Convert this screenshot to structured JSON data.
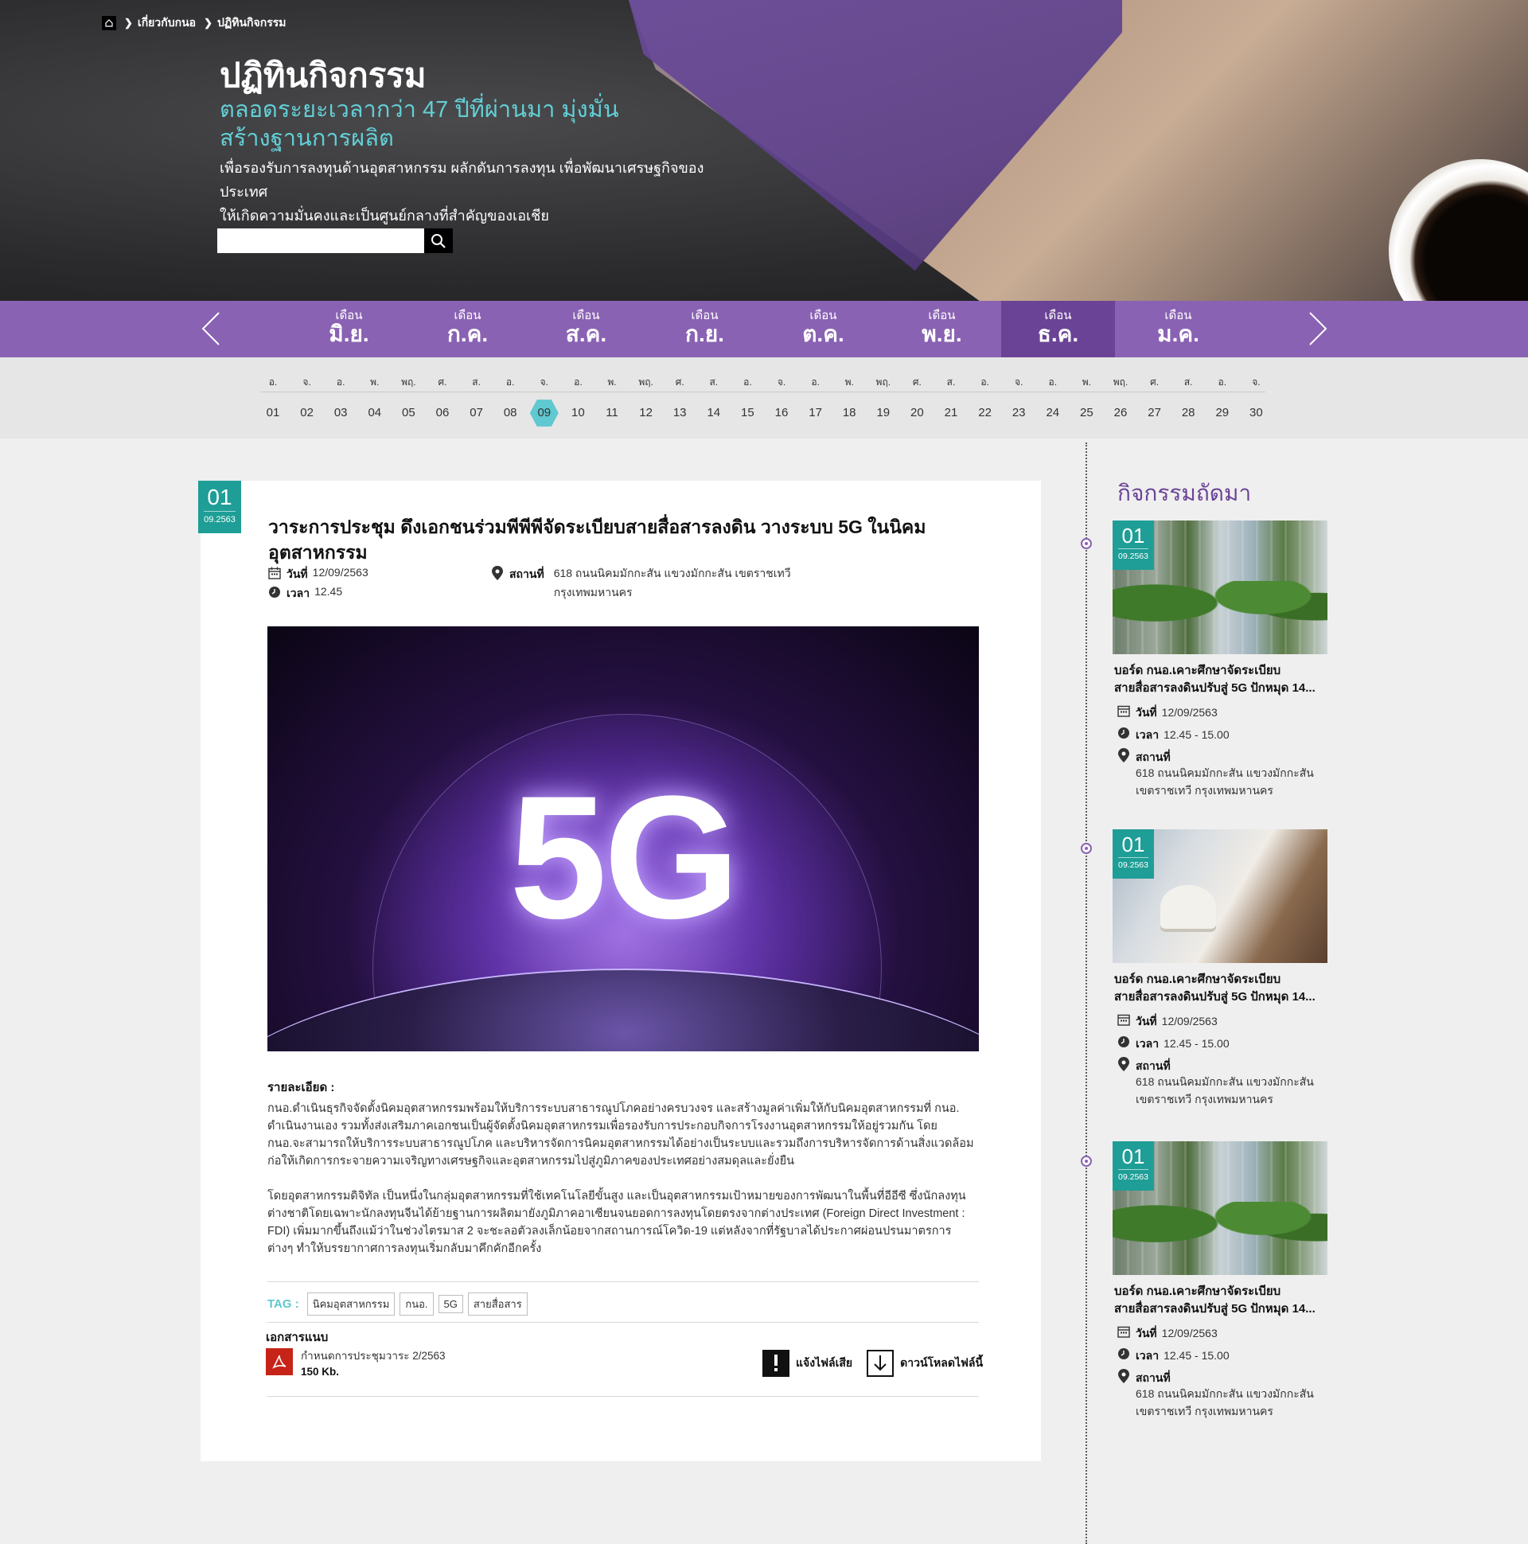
{
  "breadcrumb": {
    "items": [
      "เกี่ยวกับกนอ",
      "ปฏิทินกิจกรรม"
    ]
  },
  "hero": {
    "title": "ปฏิทินกิจกรรม",
    "subtitle": "ตลอดระยะเวลากว่า 47 ปีที่ผ่านมา มุ่งมั่นสร้างฐานการผลิต",
    "description_line1": "เพื่อรองรับการลงทุนด้านอุตสาหกรรม ผลักดันการลงทุน เพื่อพัฒนาเศรษฐกิจของประเทศ",
    "description_line2": "ให้เกิดความมั่นคงและเป็นศูนย์กลางที่สำคัญของเอเชีย",
    "search_placeholder": ""
  },
  "months": [
    {
      "small": "เดือน",
      "big": "มิ.ย.",
      "active": false
    },
    {
      "small": "เดือน",
      "big": "ก.ค.",
      "active": false
    },
    {
      "small": "เดือน",
      "big": "ส.ค.",
      "active": false
    },
    {
      "small": "เดือน",
      "big": "ก.ย.",
      "active": false
    },
    {
      "small": "เดือน",
      "big": "ต.ค.",
      "active": false
    },
    {
      "small": "เดือน",
      "big": "พ.ย.",
      "active": false
    },
    {
      "small": "เดือน",
      "big": "ธ.ค.",
      "active": true
    },
    {
      "small": "เดือน",
      "big": "ม.ค.",
      "active": false
    }
  ],
  "days": {
    "weekdays": [
      "อ.",
      "จ.",
      "อ.",
      "พ.",
      "พฤ.",
      "ศ.",
      "ส.",
      "อ.",
      "จ.",
      "อ.",
      "พ.",
      "พฤ.",
      "ศ.",
      "ส.",
      "อ.",
      "จ.",
      "อ.",
      "พ.",
      "พฤ.",
      "ศ.",
      "ส.",
      "อ.",
      "จ.",
      "อ.",
      "พ.",
      "พฤ.",
      "ศ.",
      "ส.",
      "อ.",
      "จ."
    ],
    "numbers": [
      "01",
      "02",
      "03",
      "04",
      "05",
      "06",
      "07",
      "08",
      "09",
      "10",
      "11",
      "12",
      "13",
      "14",
      "15",
      "16",
      "17",
      "18",
      "19",
      "20",
      "21",
      "22",
      "23",
      "24",
      "25",
      "26",
      "27",
      "28",
      "29",
      "30"
    ],
    "active": "09"
  },
  "article": {
    "badge_day": "01",
    "badge_month": "09.2563",
    "title": "วาระการประชุม ดึงเอกชนร่วมพีพีพีจัดระเบียบสายสื่อสารลงดิน วางระบบ 5G ในนิคมอุตสาหกรรม",
    "date_label": "วันที่",
    "date_value": "12/09/2563",
    "time_label": "เวลา",
    "time_value": "12.45",
    "place_label": "สถานที่",
    "place_line1": "618 ถนนนิคมมักกะสัน แขวงมักกะสัน เขตราชเทวี",
    "place_line2": "กรุงเทพมหานคร",
    "image_text": "5G",
    "detail_heading": "รายละเอียด :",
    "detail_p1": "กนอ.ดำเนินธุรกิจจัดตั้งนิคมอุตสาหกรรมพร้อมให้บริการระบบสาธารณูปโภคอย่างครบวงจร และสร้างมูลค่าเพิ่มให้กับนิคมอุตสาหกรรมที่ กนอ. ดำเนินงานเอง รวมทั้งส่งเสริมภาคเอกชนเป็นผู้จัดตั้งนิคมอุตสาหกรรมเพื่อรองรับการประกอบกิจการโรงงานอุตสาหกรรมให้อยู่รวมกัน โดย กนอ.จะสามารถให้บริการระบบสาธารณูปโภค และบริหารจัดการนิคมอุตสาหกรรมได้อย่างเป็นระบบและรวมถึงการบริหารจัดการด้านสิ่งแวดล้อม ก่อให้เกิดการกระจายความเจริญทางเศรษฐกิจและอุตสาหกรรมไปสู่ภูมิภาคของประเทศอย่างสมดุลและยั่งยืน",
    "detail_p2": "โดยอุตสาหกรรมดิจิทัล เป็นหนึ่งในกลุ่มอุตสาหกรรมที่ใช้เทคโนโลยีขั้นสูง และเป็นอุตสาหกรรมเป้าหมายของการพัฒนาในพื้นที่อีอีซี ซึ่งนักลงทุนต่างชาติโดยเฉพาะนักลงทุนจีนได้ย้ายฐานการผลิตมายังภูมิภาคอาเซียนจนยอดการลงทุนโดยตรงจากต่างประเทศ (Foreign Direct Investment : FDI) เพิ่มมากขึ้นถึงแม้ว่าในช่วงไตรมาส 2 จะชะลอตัวลงเล็กน้อยจากสถานการณ์โควิด-19 แต่หลังจากที่รัฐบาลได้ประกาศผ่อนปรนมาตรการต่างๆ ทำให้บรรยากาศการลงทุนเริ่มกลับมาคึกคักอีกครั้ง",
    "tag_label": "TAG :",
    "tags": [
      "นิคมอุตสาหกรรม",
      "กนอ.",
      "5G",
      "สายสื่อสาร"
    ],
    "attachments_heading": "เอกสารแนบ",
    "file_name": "กำหนดการประชุมวาระ 2/2563",
    "file_size": "150 Kb.",
    "report_label": "แจ้งไฟล์เสีย",
    "download_label": "ดาวน์โหลดไฟล์นี้"
  },
  "sidebar": {
    "title": "กิจกรรมถัดมา",
    "cards": [
      {
        "badge_day": "01",
        "badge_month": "09.2563",
        "title_line1": "บอร์ด กนอ.เคาะศึกษาจัดระเบียบ",
        "title_line2": "สายสื่อสารลงดินปรับสู่ 5G ปักหมุด 14...",
        "date_label": "วันที่",
        "date_value": "12/09/2563",
        "time_label": "เวลา",
        "time_value": "12.45 - 15.00",
        "place_label": "สถานที่",
        "place_line1": "618 ถนนนิคมมักกะสัน แขวงมักกะสัน",
        "place_line2": "เขตราชเทวี กรุงเทพมหานคร",
        "image": "city-trees"
      },
      {
        "badge_day": "01",
        "badge_month": "09.2563",
        "title_line1": "บอร์ด กนอ.เคาะศึกษาจัดระเบียบ",
        "title_line2": "สายสื่อสารลงดินปรับสู่ 5G ปักหมุด 14...",
        "date_label": "วันที่",
        "date_value": "12/09/2563",
        "time_label": "เวลา",
        "time_value": "12.45 - 15.00",
        "place_label": "สถานที่",
        "place_line1": "618 ถนนนิคมมักกะสัน แขวงมักกะสัน",
        "place_line2": "เขตราชเทวี กรุงเทพมหานคร",
        "image": "handshake"
      },
      {
        "badge_day": "01",
        "badge_month": "09.2563",
        "title_line1": "บอร์ด กนอ.เคาะศึกษาจัดระเบียบ",
        "title_line2": "สายสื่อสารลงดินปรับสู่ 5G ปักหมุด 14...",
        "date_label": "วันที่",
        "date_value": "12/09/2563",
        "time_label": "เวลา",
        "time_value": "12.45 - 15.00",
        "place_label": "สถานที่",
        "place_line1": "618 ถนนนิคมมักกะสัน แขวงมักกะสัน",
        "place_line2": "เขตราชเทวี กรุงเทพมหานคร",
        "image": "city-trees"
      }
    ]
  },
  "colors": {
    "purple": "#8a62b3",
    "purple_active": "#6a4396",
    "teal": "#1e9e96",
    "teal_light": "#5fc8d0",
    "pdf_red": "#c62418"
  }
}
